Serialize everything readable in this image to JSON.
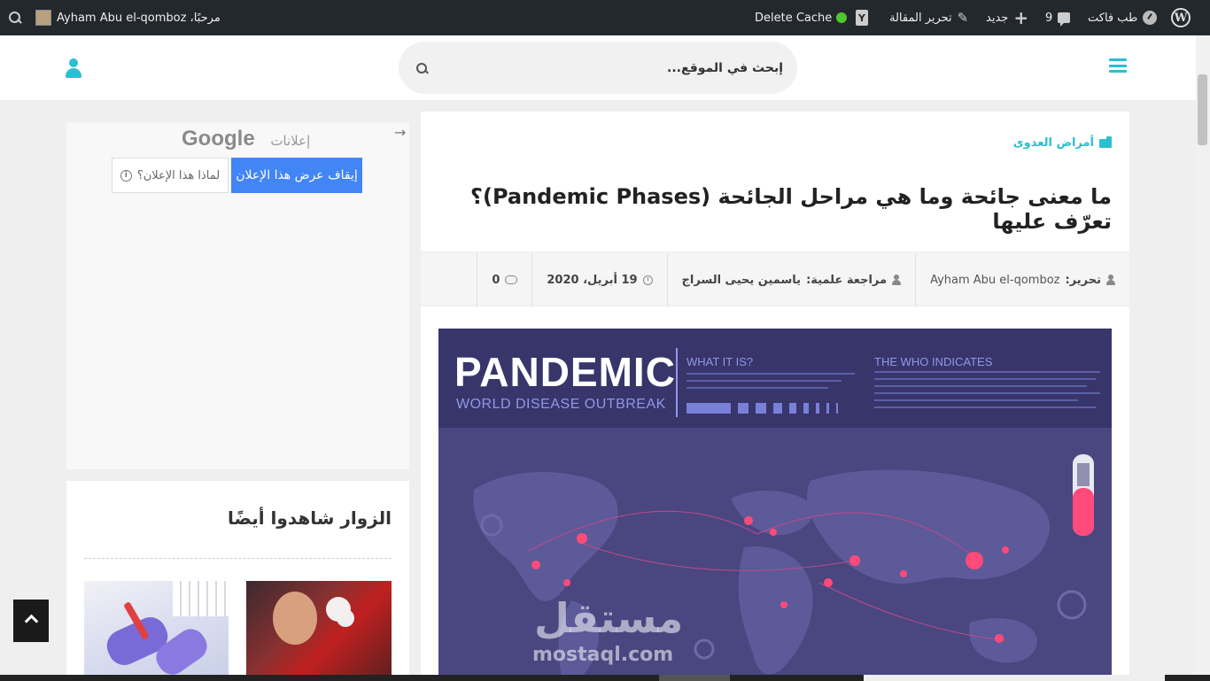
{
  "adminbar": {
    "site_name": "طب فاكت",
    "comments_count": "9",
    "new_label": "جديد",
    "edit_label": "تحرير المقالة",
    "cache_label": "Delete Cache",
    "greeting": "مرحبًا، Ayham Abu el-qomboz",
    "bar_color": "#23282d"
  },
  "header": {
    "search_placeholder": "إبحث في الموقع...",
    "accent_color": "#2bbfd1"
  },
  "article": {
    "category": "أمراض العدوى",
    "title": "ما معنى جائحة وما هي مراحل الجائحة (Pandemic Phases)؟ تعرّف عليها",
    "meta": {
      "author_label": "تحرير:",
      "author": "Ayham Abu el-qomboz",
      "reviewer_label": "مراجعة علمية:",
      "reviewer": "ياسمين يحيى السراج",
      "date": "19 أبريل، 2020",
      "comments": "0"
    },
    "featured": {
      "big_title": "PANDEMIC",
      "subtitle": "WORLD DISEASE OUTBREAK",
      "what_label": "WHAT IT IS?",
      "who_label": "THE WHO INDICATES",
      "watermark": "مستقل",
      "watermark_sub": "mostaql.com"
    }
  },
  "sidebar": {
    "ad": {
      "label": "إعلانات",
      "brand": "Google",
      "stop_button": "إيقاف عرض هذا الإعلان",
      "why_button": "لماذا هذا الإعلان؟"
    },
    "viewed_title": "الزوار شاهدوا أيضًا"
  }
}
